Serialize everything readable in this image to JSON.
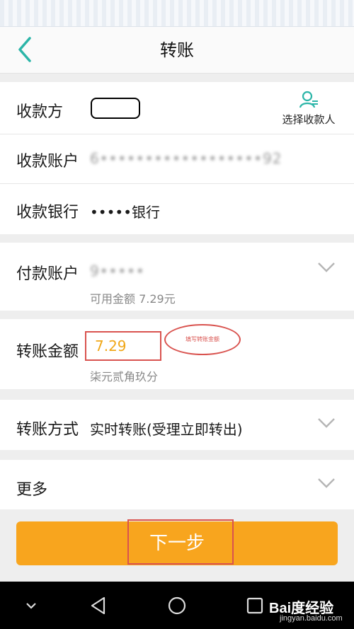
{
  "header": {
    "title": "转账"
  },
  "payee_section": {
    "payee_label": "收款方",
    "choose_payee_label": "选择收款人",
    "account_label": "收款账户",
    "account_value": "6••••••••••••••••••92",
    "bank_label": "收款银行",
    "bank_value": "•••••银行"
  },
  "payer_section": {
    "account_label": "付款账户",
    "account_value": "9•••••",
    "balance_text": "可用金额 7.29元"
  },
  "amount_section": {
    "label": "转账金额",
    "amount_value": "7.29",
    "amount_in_words": "柒元贰角玖分",
    "annotation_text": "填写转账金额"
  },
  "method_section": {
    "label": "转账方式",
    "value": "实时转账(受理立即转出)"
  },
  "more_section": {
    "label": "更多"
  },
  "actions": {
    "next_label": "下一步"
  },
  "watermark": {
    "brand": "Bai度经验",
    "site": "jingyan.baidu.com"
  },
  "colors": {
    "accent": "#f8a51e",
    "amount_text": "#f0a718",
    "teal": "#2bb5a8",
    "annotation_red": "#d9534f"
  }
}
